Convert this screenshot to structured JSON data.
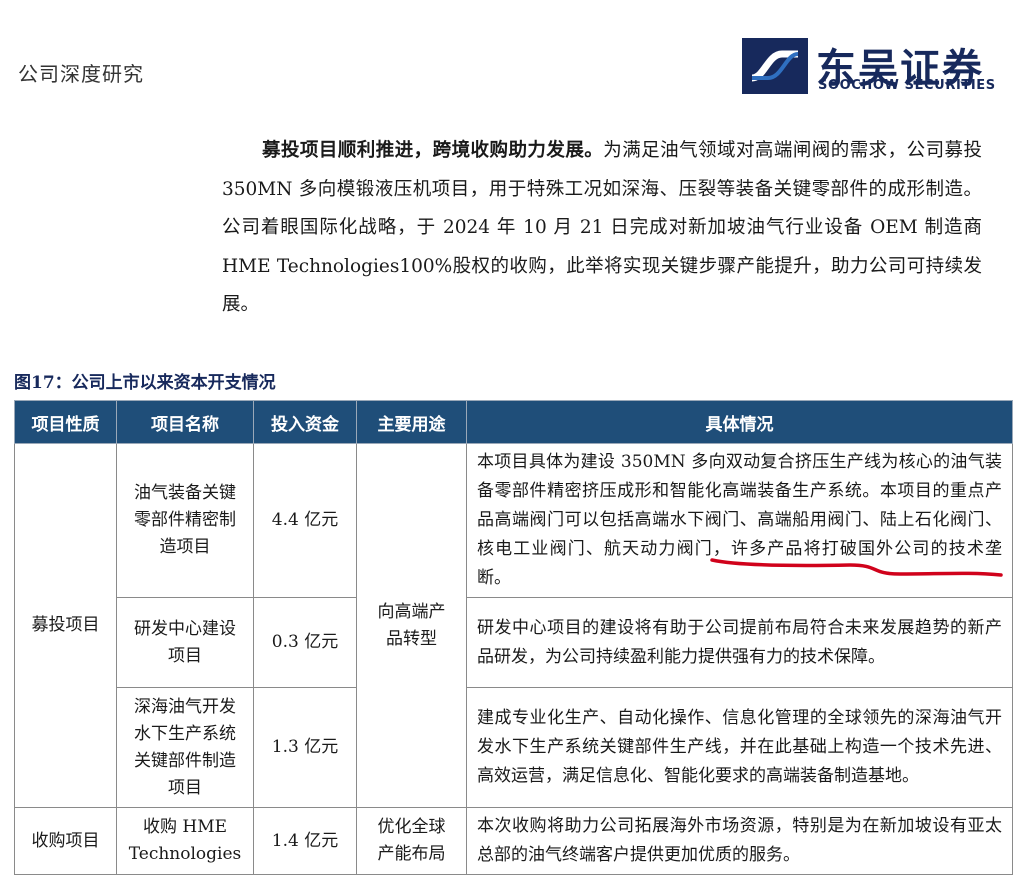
{
  "header": {
    "section": "公司深度研究",
    "logo_cn": "东吴证券",
    "logo_en": "SOOCHOW SECURITIES"
  },
  "paragraph": {
    "lead": "募投项目顺利推进，跨境收购助力发展。",
    "body": "为满足油气领域对高端闸阀的需求，公司募投 350MN 多向模锻液压机项目，用于特殊工况如深海、压裂等装备关键零部件的成形制造。公司着眼国际化战略，于 2024 年 10 月 21 日完成对新加坡油气行业设备 OEM 制造商 HME Technologies100%股权的收购，此举将实现关键步骤产能提升，助力公司可持续发展。"
  },
  "figure": {
    "title": "图17：公司上市以来资本开支情况"
  },
  "table": {
    "headers": [
      "项目性质",
      "项目名称",
      "投入资金",
      "主要用途",
      "具体情况"
    ],
    "group1": {
      "nature": "募投项目",
      "purpose": "向高端产品转型",
      "rows": [
        {
          "name": "油气装备关键零部件精密制造项目",
          "amount": "4.4 亿元",
          "detail": "本项目具体为建设 350MN 多向双动复合挤压生产线为核心的油气装备零部件精密挤压成形和智能化高端装备生产系统。本项目的重点产品高端阀门可以包括高端水下阀门、高端船用阀门、陆上石化阀门、核电工业阀门、航天动力阀门，许多产品将打破国外公司的技术垄断。"
        },
        {
          "name": "研发中心建设项目",
          "amount": "0.3 亿元",
          "detail": "研发中心项目的建设将有助于公司提前布局符合未来发展趋势的新产品研发，为公司持续盈利能力提供强有力的技术保障。"
        },
        {
          "name": "深海油气开发水下生产系统关键部件制造项目",
          "amount": "1.3 亿元",
          "detail": "建成专业化生产、自动化操作、信息化管理的全球领先的深海油气开发水下生产系统关键部件生产线，并在此基础上构造一个技术先进、高效运营，满足信息化、智能化要求的高端装备制造基地。"
        }
      ]
    },
    "group2": {
      "nature": "收购项目",
      "name": "收购 HME Technologies",
      "amount": "1.4 亿元",
      "purpose": "优化全球产能布局",
      "detail": "本次收购将助力公司拓展海外市场资源，特别是为在新加坡设有亚太总部的油气终端客户提供更加优质的服务。"
    }
  },
  "colors": {
    "header_bg": "#1f4e79",
    "brand": "#17295c",
    "annotation": "#d0021b"
  }
}
